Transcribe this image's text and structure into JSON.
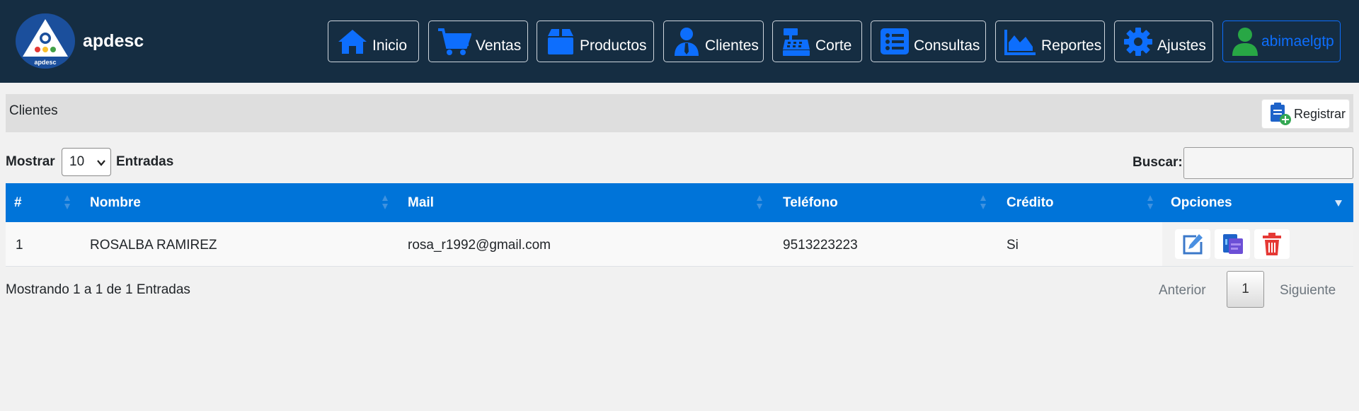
{
  "header": {
    "brand": "apdesc",
    "logo_text": "apdesc",
    "nav": [
      {
        "label": "Inicio",
        "icon": "home-icon"
      },
      {
        "label": "Ventas",
        "icon": "cart-icon"
      },
      {
        "label": "Productos",
        "icon": "box-icon"
      },
      {
        "label": "Clientes",
        "icon": "user-tie-icon"
      },
      {
        "label": "Corte",
        "icon": "cash-register-icon"
      },
      {
        "label": "Consultas",
        "icon": "list-icon"
      },
      {
        "label": "Reportes",
        "icon": "area-chart-icon"
      },
      {
        "label": "Ajustes",
        "icon": "gear-icon"
      }
    ],
    "user": {
      "label": "abimaelgtp",
      "icon": "user-icon"
    }
  },
  "panel": {
    "title": "Clientes",
    "register_label": "Registrar"
  },
  "controls": {
    "show_label": "Mostrar",
    "page_size": "10",
    "entries_label": "Entradas",
    "search_label": "Buscar:",
    "search_value": ""
  },
  "table": {
    "columns": [
      "#",
      "Nombre",
      "Mail",
      "Teléfono",
      "Crédito",
      "Opciones"
    ],
    "rows": [
      {
        "num": "1",
        "name": "ROSALBA RAMIREZ",
        "mail": "rosa_r1992@gmail.com",
        "phone": "9513223223",
        "credit": "Si"
      }
    ],
    "row_actions": [
      "edit-icon",
      "credit-card-icon",
      "trash-icon"
    ]
  },
  "pagination": {
    "info": "Mostrando 1 a 1 de 1 Entradas",
    "prev": "Anterior",
    "current": "1",
    "next": "Siguiente"
  },
  "colors": {
    "navbar": "#152d42",
    "accent": "#0d6efd",
    "table_header": "#0074d9",
    "delete": "#e53935"
  }
}
